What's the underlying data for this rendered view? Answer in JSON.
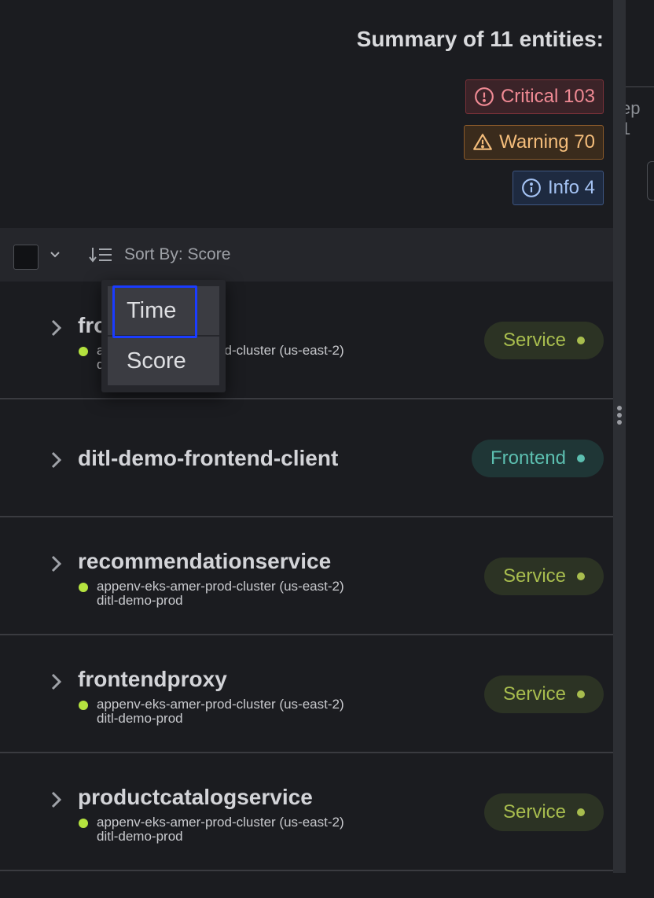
{
  "summary": {
    "title": "Summary of 11 entities:",
    "critical": "Critical 103",
    "warning": "Warning 70",
    "info": "Info 4"
  },
  "edge": {
    "partial_text": "ep 1"
  },
  "toolbar": {
    "sort_label": "Sort By: Score"
  },
  "sort_menu": {
    "options": [
      "Time",
      "Score"
    ],
    "focused": "Time"
  },
  "entities": [
    {
      "name": "frontend",
      "cluster": "appenv-eks-amer-prod-cluster (us-east-2)",
      "namespace": "ditl-demo-prod",
      "tag": "Service"
    },
    {
      "name": "ditl-demo-frontend-client",
      "cluster": "",
      "namespace": "",
      "tag": "Frontend"
    },
    {
      "name": "recommendationservice",
      "cluster": "appenv-eks-amer-prod-cluster (us-east-2)",
      "namespace": "ditl-demo-prod",
      "tag": "Service"
    },
    {
      "name": "frontendproxy",
      "cluster": "appenv-eks-amer-prod-cluster (us-east-2)",
      "namespace": "ditl-demo-prod",
      "tag": "Service"
    },
    {
      "name": "productcatalogservice",
      "cluster": "appenv-eks-amer-prod-cluster (us-east-2)",
      "namespace": "ditl-demo-prod",
      "tag": "Service"
    }
  ],
  "colors": {
    "critical": "#f08a94",
    "warning": "#f4bd7b",
    "info": "#a5c3f4",
    "service": "#a8bd4e",
    "frontend": "#5cbfb0",
    "focus": "#1a3cff"
  }
}
